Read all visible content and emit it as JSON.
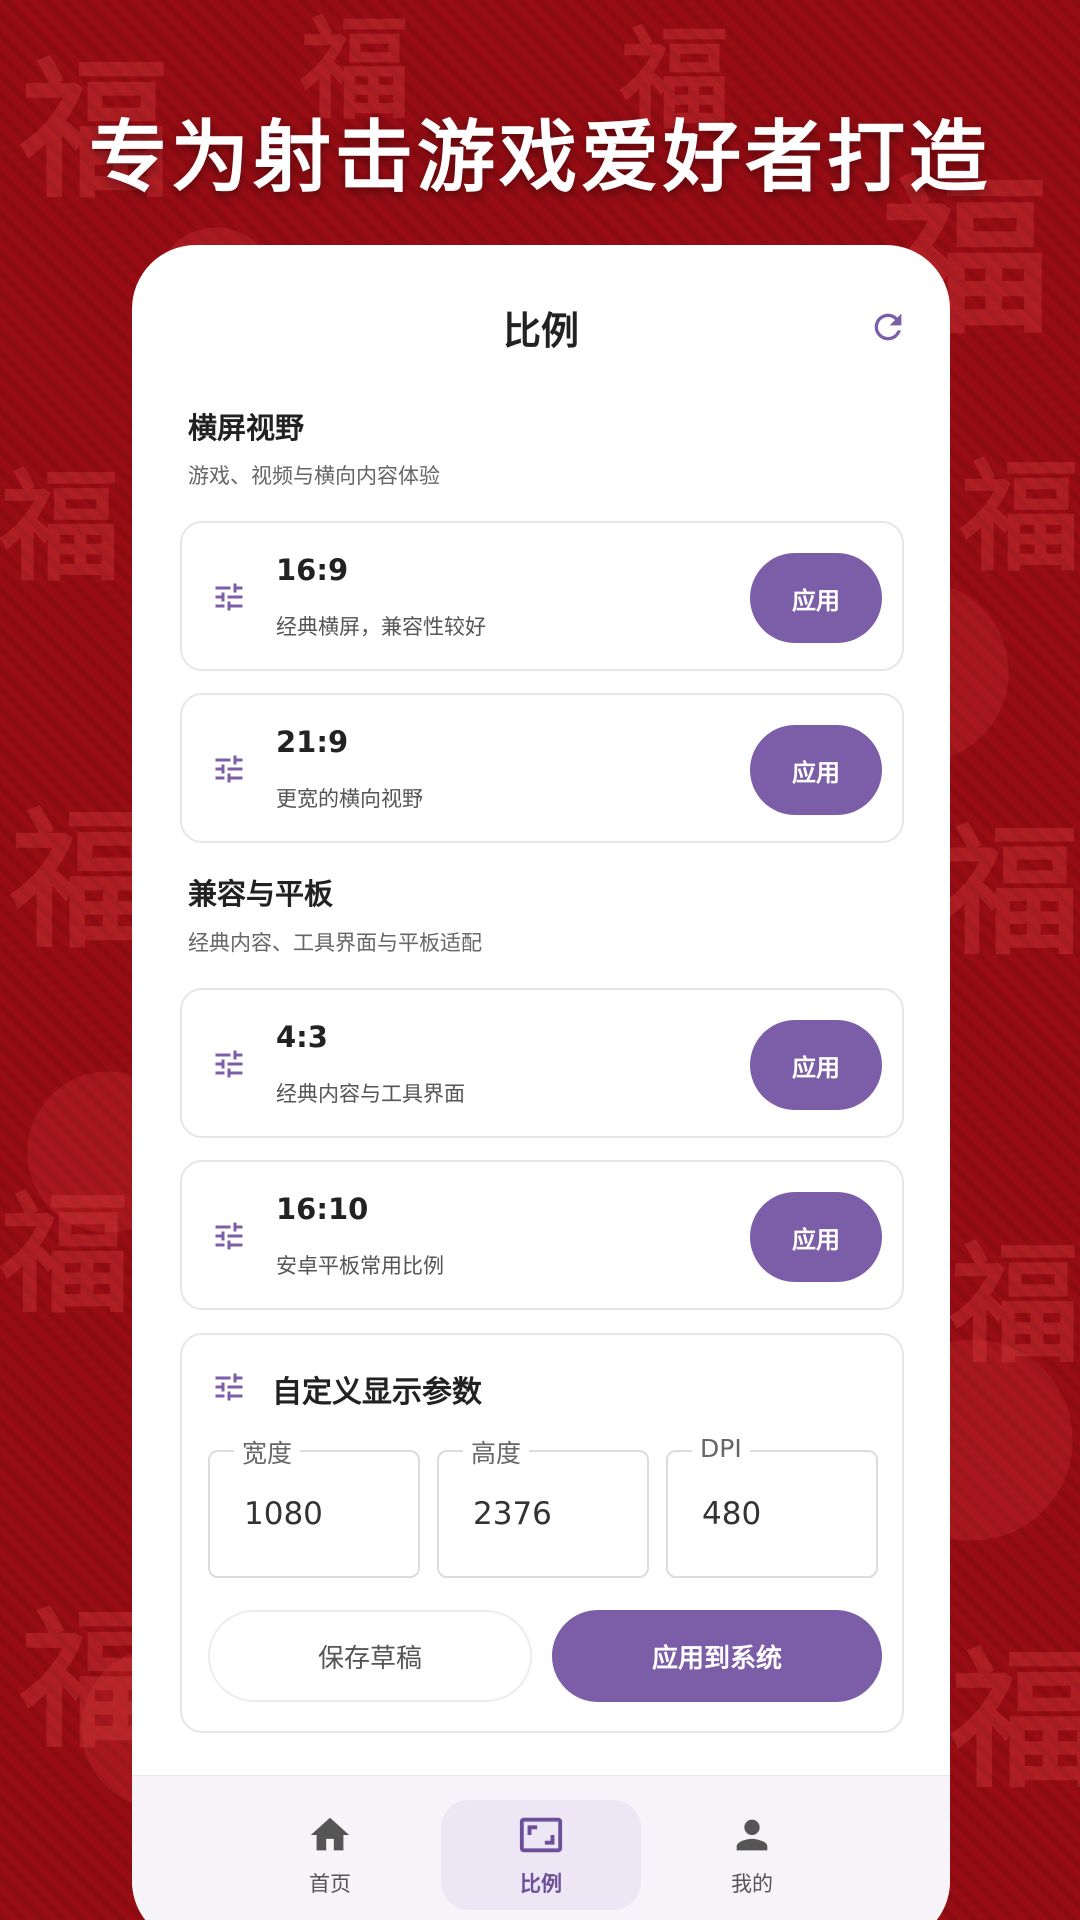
{
  "headline": "专为射击游戏爱好者打造",
  "colors": {
    "accent": "#7b5ea7",
    "background": "#980d14"
  },
  "header": {
    "title": "比例",
    "refresh_icon": "refresh-icon"
  },
  "sections": [
    {
      "title": "横屏视野",
      "subtitle": "游戏、视频与横向内容体验"
    },
    {
      "title": "兼容与平板",
      "subtitle": "经典内容、工具界面与平板适配"
    }
  ],
  "ratios": [
    {
      "ratio": "16:9",
      "desc": "经典横屏，兼容性较好",
      "button": "应用"
    },
    {
      "ratio": "21:9",
      "desc": "更宽的横向视野",
      "button": "应用"
    },
    {
      "ratio": "4:3",
      "desc": "经典内容与工具界面",
      "button": "应用"
    },
    {
      "ratio": "16:10",
      "desc": "安卓平板常用比例",
      "button": "应用"
    }
  ],
  "custom": {
    "title": "自定义显示参数",
    "width_label": "宽度",
    "width_value": "1080",
    "height_label": "高度",
    "height_value": "2376",
    "dpi_label": "DPI",
    "dpi_value": "480",
    "save_label": "保存草稿",
    "apply_label": "应用到系统"
  },
  "nav": {
    "items": [
      {
        "label": "首页",
        "icon": "home-icon"
      },
      {
        "label": "比例",
        "icon": "aspect-ratio-icon"
      },
      {
        "label": "我的",
        "icon": "person-icon"
      }
    ],
    "active": "比例"
  }
}
